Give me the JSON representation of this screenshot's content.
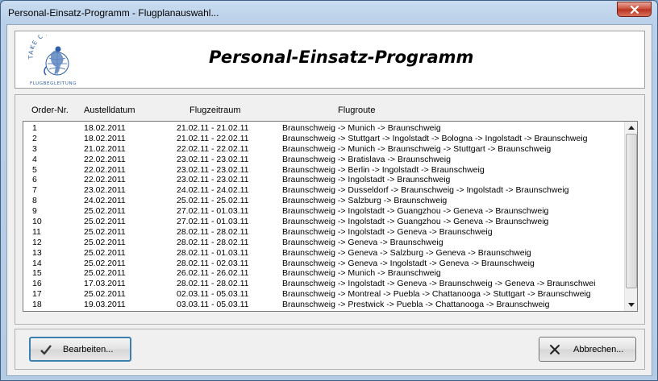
{
  "window": {
    "title": "Personal-Einsatz-Programm - Flugplanauswahl..."
  },
  "header": {
    "title": "Personal-Einsatz-Programm",
    "logo": {
      "top_text": "TAKE C'AIR",
      "bottom_text": "FLUGBEGLEITUNG"
    }
  },
  "table": {
    "columns": [
      "Order-Nr.",
      "Austelldatum",
      "Flugzeitraum",
      "Flugroute"
    ],
    "rows": [
      [
        "1",
        "18.02.2011",
        "21.02.11 - 21.02.11",
        "Braunschweig  -> Munich -> Braunschweig"
      ],
      [
        "2",
        "18.02.2011",
        "21.02.11 - 22.02.11",
        "Braunschweig  -> Stuttgart -> Ingolstadt  -> Bologna  -> Ingolstadt  -> Braunschweig"
      ],
      [
        "3",
        "21.02.2011",
        "22.02.11 - 22.02.11",
        "Braunschweig  -> Munich -> Braunschweig  -> Stuttgart -> Braunschweig"
      ],
      [
        "4",
        "22.02.2011",
        "23.02.11 - 23.02.11",
        "Braunschweig  -> Bratislava  -> Braunschweig"
      ],
      [
        "5",
        "22.02.2011",
        "23.02.11 - 23.02.11",
        "Braunschweig  -> Berlin  -> Ingolstadt  -> Braunschweig"
      ],
      [
        "6",
        "22.02.2011",
        "23.02.11 - 23.02.11",
        "Braunschweig  -> Ingolstadt  -> Braunschweig"
      ],
      [
        "7",
        "23.02.2011",
        "24.02.11 - 24.02.11",
        "Braunschweig  -> Dusseldorf -> Braunschweig  -> Ingolstadt  -> Braunschweig"
      ],
      [
        "8",
        "24.02.2011",
        "25.02.11 - 25.02.11",
        "Braunschweig  -> Salzburg -> Braunschweig"
      ],
      [
        "9",
        "25.02.2011",
        "27.02.11 - 01.03.11",
        "Braunschweig  -> Ingolstadt  -> Guangzhou -> Geneva  -> Braunschweig"
      ],
      [
        "10",
        "25.02.2011",
        "27.02.11 - 01.03.11",
        "Braunschweig  -> Ingolstadt  -> Guangzhou -> Geneva  -> Braunschweig"
      ],
      [
        "11",
        "25.02.2011",
        "28.02.11 - 28.02.11",
        "Braunschweig  -> Ingolstadt  -> Geneva  -> Braunschweig"
      ],
      [
        "12",
        "25.02.2011",
        "28.02.11 - 28.02.11",
        "Braunschweig  -> Geneva  -> Braunschweig"
      ],
      [
        "13",
        "25.02.2011",
        "28.02.11 - 01.03.11",
        "Braunschweig  -> Geneva  -> Salzburg -> Geneva  -> Braunschweig"
      ],
      [
        "14",
        "25.02.2011",
        "28.02.11 - 02.03.11",
        "Braunschweig  -> Geneva  -> Ingolstadt  -> Geneva  -> Braunschweig"
      ],
      [
        "15",
        "25.02.2011",
        "26.02.11 - 26.02.11",
        "Braunschweig  -> Munich -> Braunschweig"
      ],
      [
        "16",
        "17.03.2011",
        "28.02.11 - 28.02.11",
        "Braunschweig  -> Ingolstadt  -> Geneva  -> Braunschweig  -> Geneva  -> Braunschwei"
      ],
      [
        "17",
        "25.02.2011",
        "02.03.11 - 05.03.11",
        "Braunschweig  -> Montreal  -> Puebla  -> Chattanooga  -> Stuttgart -> Braunschweig"
      ],
      [
        "18",
        "19.03.2011",
        "03.03.11 - 05.03.11",
        "Braunschweig  -> Prestwick -> Puebla -> Chattanooga -> Braunschweig"
      ]
    ]
  },
  "buttons": {
    "edit_label": "Bearbeiten...",
    "cancel_label": "Abbrechen..."
  },
  "icons": {
    "close": "close-icon",
    "check": "check-icon",
    "cross": "cross-icon",
    "scroll_up": "scroll-up-icon",
    "scroll_down": "scroll-down-icon"
  },
  "colors": {
    "title_bar": "#b9cfe8",
    "close_button": "#c74a36",
    "default_button_border": "#3c7fb1",
    "logo_blue": "#2f5fa8"
  }
}
